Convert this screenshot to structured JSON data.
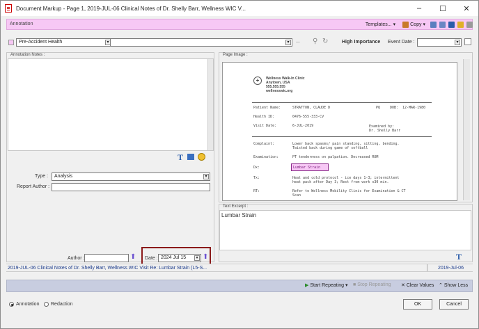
{
  "window": {
    "title": "Document Markup - Page 1, 2019-JUL-06 Clinical Notes of Dr. Shelly Barr, Wellness WIC V...",
    "minimize": "–",
    "maximize": "☐",
    "close": "✕"
  },
  "toolbar": {
    "annotation_label": "Annotation",
    "templates_label": "Templates...",
    "copy_label": "Copy",
    "category_value": "Pre-Accident Health",
    "subcategory_value": "",
    "ellipsis": "...",
    "high_importance_label": "High Importance",
    "event_date_label": "Event Date :",
    "event_date_value": ""
  },
  "left_panel": {
    "notes_title": "Annotation Notes :",
    "type_label": "Type :",
    "type_value": "Analysis",
    "report_author_label": "Report Author :",
    "report_author_value": "",
    "author_label": "Author :",
    "author_value": "",
    "date_label": "Date :",
    "date_value": "2024 Jul 15"
  },
  "right_panel": {
    "page_image_title": "Page Image :",
    "text_excerpt_title": "Text Excerpt :",
    "text_excerpt_value": "Lumbar Strain"
  },
  "page_image": {
    "clinic_lines": [
      "Wellness Walk-In Clinic",
      "Anytown, USA",
      "555.555.555",
      "wellnesswic.org"
    ],
    "patient_name_label": "Patient Name:",
    "patient_name_value": "STRATTON, CLAUDE D",
    "pq_label": "PQ",
    "dob_label": "DOB:",
    "dob_value": "12-MAR-1980",
    "health_id_label": "Health ID:",
    "health_id_value": "0476-555-333-CV",
    "visit_date_label": "Visit Date:",
    "visit_date_value": "6-JUL-2019",
    "examined_by_label": "Examined by:",
    "examined_by_value": "Dr. Shelly Barr",
    "complaint_label": "Complaint:",
    "complaint_line1": "Lower back spasms/ pain standing, sitting, bending.",
    "complaint_line2": "Twisted back during game of softball",
    "examination_label": "Examination:",
    "examination_value": "PT tenderness on palpation. Decreased ROM",
    "dx_label": "Dx:",
    "dx_value": "Lumbar Strain",
    "tx_label": "Tx:",
    "tx_line1": "Heat and cold protocol - ice days 1-3; intermittent",
    "tx_line2": "heat pack after Day 3; Rest from work x30 min.",
    "rt_label": "RT:",
    "rt_line1": "Refer to Wellness Mobility Clinic for Examination & CT",
    "rt_line2": "Scan"
  },
  "status": {
    "left_text": "2019-JUL-06 Clinical Notes of Dr. Shelly Barr, Wellness WIC Visit Re: Lumbar Strain (L5-S...",
    "right_text": "2019-Jul-06"
  },
  "actions": {
    "start_repeating": "Start Repeating",
    "stop_repeating": "Stop Repeating",
    "clear_values": "Clear Values",
    "show_less": "Show Less"
  },
  "footer": {
    "annotation_radio": "Annotation",
    "redaction_radio": "Redaction",
    "ok": "OK",
    "cancel": "Cancel"
  },
  "colors": {
    "annotation_pink": "#f7c8f5",
    "highlight_box": "#8b1a1a",
    "action_bar": "#c8cde0"
  }
}
